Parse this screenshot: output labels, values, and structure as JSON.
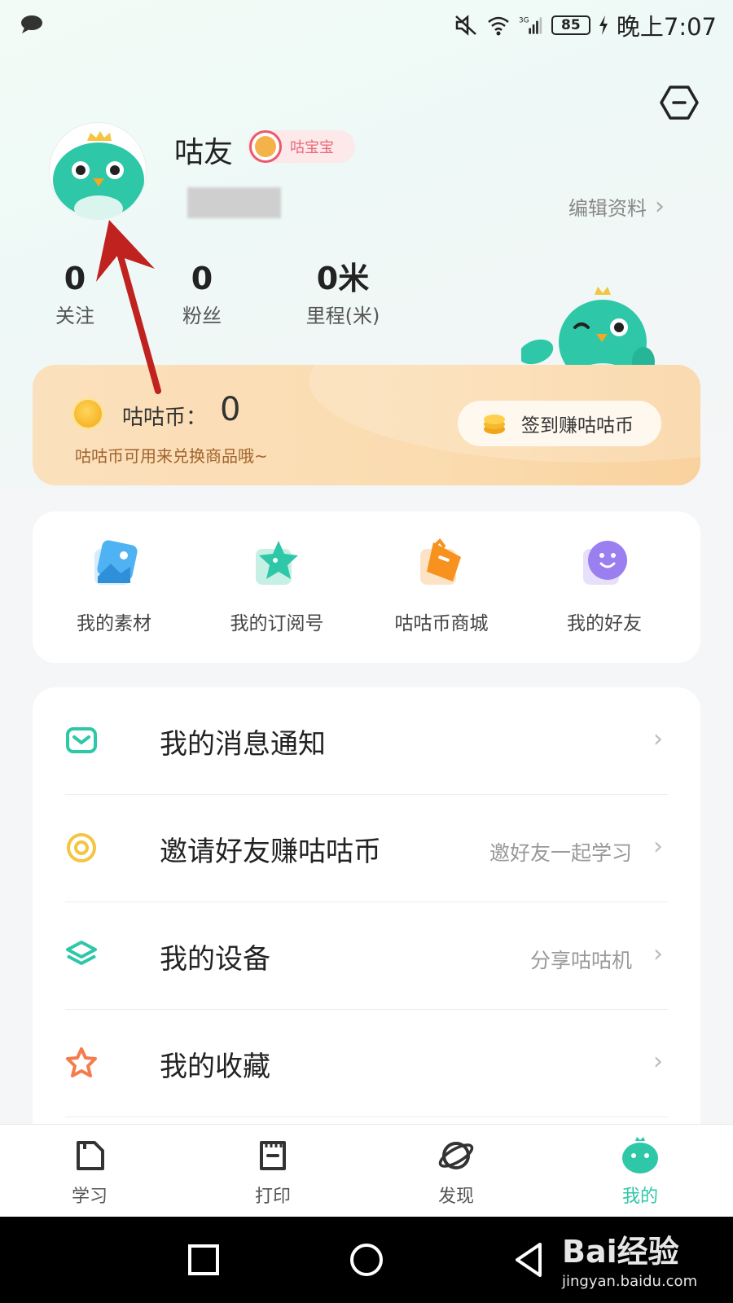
{
  "status_bar": {
    "battery": "85",
    "time": "晚上7:07",
    "network": "3G"
  },
  "profile": {
    "username": "咕友",
    "badge": "咕宝宝",
    "edit_label": "编辑资料"
  },
  "stats": [
    {
      "value": "0",
      "label": "关注"
    },
    {
      "value": "0",
      "label": "粉丝"
    },
    {
      "value": "0米",
      "label": "里程(米)"
    }
  ],
  "coin_card": {
    "label": "咕咕币：",
    "value": "0",
    "subtitle": "咕咕币可用来兑换商品哦~",
    "signin_label": "签到赚咕咕币"
  },
  "quick_links": [
    {
      "label": "我的素材",
      "icon": "material-icon"
    },
    {
      "label": "我的订阅号",
      "icon": "star-icon"
    },
    {
      "label": "咕咕币商城",
      "icon": "shopping-bag-icon"
    },
    {
      "label": "我的好友",
      "icon": "friend-icon"
    }
  ],
  "menu": [
    {
      "title": "我的消息通知",
      "subtitle": "",
      "icon": "message-icon"
    },
    {
      "title": "邀请好友赚咕咕币",
      "subtitle": "邀好友一起学习",
      "icon": "invite-icon"
    },
    {
      "title": "我的设备",
      "subtitle": "分享咕咕机",
      "icon": "layers-icon"
    },
    {
      "title": "我的收藏",
      "subtitle": "",
      "icon": "star-outline-icon"
    }
  ],
  "tabs": [
    {
      "label": "学习",
      "icon": "study-icon",
      "active": false
    },
    {
      "label": "打印",
      "icon": "print-icon",
      "active": false
    },
    {
      "label": "发现",
      "icon": "planet-icon",
      "active": false
    },
    {
      "label": "我的",
      "icon": "mascot-icon",
      "active": true
    }
  ],
  "watermark": {
    "main": "Bai经验",
    "sub": "jingyan.baidu.com"
  },
  "colors": {
    "accent": "#2ec7a7",
    "coin_card": "#fbdcb0",
    "annotation": "#c0231f"
  }
}
